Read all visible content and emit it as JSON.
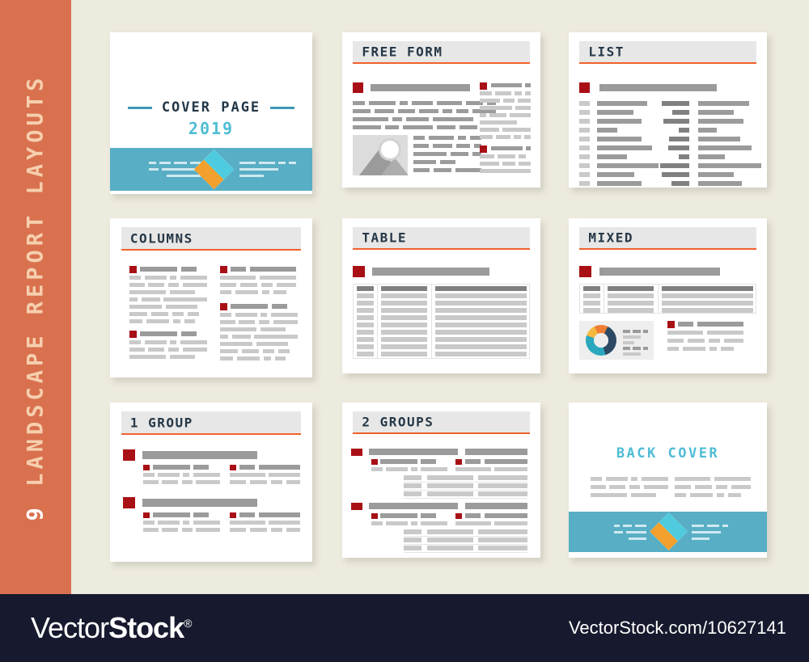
{
  "sidebar": {
    "count": "9",
    "label": "LANDSCAPE REPORT LAYOUTS",
    "color": "#d9714f",
    "text_color": "#f6cfae"
  },
  "page": {
    "background": "#edeade",
    "accent_orange": "#f2612c",
    "accent_teal": "#58aec4",
    "accent_navy": "#253746",
    "accent_red": "#a81016",
    "accent_cyan": "#4fbdd4"
  },
  "cards": [
    {
      "id": "cover-page",
      "kind": "cover",
      "title": "COVER PAGE",
      "year": "2019"
    },
    {
      "id": "free-form",
      "kind": "template",
      "title": "FREE FORM"
    },
    {
      "id": "list",
      "kind": "template",
      "title": "LIST"
    },
    {
      "id": "columns",
      "kind": "template",
      "title": "COLUMNS"
    },
    {
      "id": "table",
      "kind": "template",
      "title": "TABLE"
    },
    {
      "id": "mixed",
      "kind": "template",
      "title": "MIXED"
    },
    {
      "id": "one-group",
      "kind": "template",
      "title": "1 GROUP"
    },
    {
      "id": "two-groups",
      "kind": "template",
      "title": "2 GROUPS"
    },
    {
      "id": "back-cover",
      "kind": "back",
      "title": "BACK COVER"
    }
  ],
  "donut": {
    "type": "pie",
    "segments": [
      {
        "name": "segment-navy",
        "color": "#2c4a63",
        "value": 38
      },
      {
        "name": "segment-teal",
        "color": "#2aa8bd",
        "value": 32
      },
      {
        "name": "segment-yellow",
        "color": "#f5b841",
        "value": 16
      },
      {
        "name": "segment-orange",
        "color": "#ef7d32",
        "value": 14
      }
    ]
  },
  "footer": {
    "brand_light": "Vector",
    "brand_bold": "Stock",
    "registered": "®",
    "url": "VectorStock.com/10627141",
    "background": "#171a2e"
  }
}
